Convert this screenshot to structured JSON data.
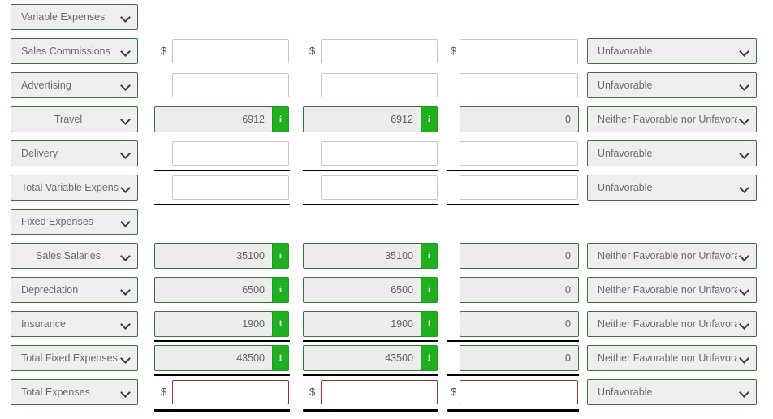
{
  "colors": {
    "select_border": "#3a7439",
    "select_fill": "#eeeeee",
    "info_green": "#1eb01e",
    "readonly_fill": "#ececec",
    "error_border": "#9b3235",
    "rule": "#000000",
    "label_text": "#6d6d6d"
  },
  "variance_options": [
    "Favorable",
    "Unfavorable",
    "Neither Favorable nor Unfavorable"
  ],
  "account_options": [
    "Variable Expenses",
    "Sales Commissions",
    "Advertising",
    "Travel",
    "Delivery",
    "Total Variable Expenses",
    "Fixed Expenses",
    "Sales Salaries",
    "Depreciation",
    "Insurance",
    "Total Fixed Expenses",
    "Total Expenses"
  ],
  "currency_symbol": "$",
  "info_icon_label": "i",
  "rows": [
    {
      "account": "Variable Expenses",
      "account_align": "left",
      "kind": "section",
      "col1": {
        "type": "none"
      },
      "col2": {
        "type": "none"
      },
      "col3": {
        "type": "none"
      },
      "variance": {
        "type": "none"
      }
    },
    {
      "account": "Sales Commissions",
      "account_align": "left",
      "kind": "entry",
      "col1": {
        "type": "input",
        "value": "",
        "dollar": true
      },
      "col2": {
        "type": "input",
        "value": "",
        "dollar": true
      },
      "col3": {
        "type": "input",
        "value": "",
        "dollar": true
      },
      "variance": {
        "type": "select",
        "value": "Unfavorable"
      }
    },
    {
      "account": "Advertising",
      "account_align": "left",
      "kind": "entry",
      "col1": {
        "type": "input",
        "value": "",
        "dollar": false
      },
      "col2": {
        "type": "input",
        "value": "",
        "dollar": false
      },
      "col3": {
        "type": "input",
        "value": "",
        "dollar": false
      },
      "variance": {
        "type": "select",
        "value": "Unfavorable"
      }
    },
    {
      "account": "Travel",
      "account_align": "center",
      "kind": "computed",
      "col1": {
        "type": "readonly",
        "value": "6912",
        "info": true
      },
      "col2": {
        "type": "readonly",
        "value": "6912",
        "info": true
      },
      "col3": {
        "type": "readonly",
        "value": "0",
        "info": false
      },
      "variance": {
        "type": "select",
        "value": "Neither Favorable nor Unfavorable"
      }
    },
    {
      "account": "Delivery",
      "account_align": "left",
      "kind": "entry",
      "col1": {
        "type": "input",
        "value": "",
        "dollar": false
      },
      "col2": {
        "type": "input",
        "value": "",
        "dollar": false
      },
      "col3": {
        "type": "input",
        "value": "",
        "dollar": false
      },
      "variance": {
        "type": "select",
        "value": "Unfavorable"
      }
    },
    {
      "account": "Total Variable Expenses",
      "account_align": "left",
      "kind": "total",
      "rule_above": true,
      "rule_below": true,
      "col1": {
        "type": "input",
        "value": "",
        "dollar": false
      },
      "col2": {
        "type": "input",
        "value": "",
        "dollar": false
      },
      "col3": {
        "type": "input",
        "value": "",
        "dollar": false
      },
      "variance": {
        "type": "select",
        "value": "Unfavorable"
      }
    },
    {
      "account": "Fixed Expenses",
      "account_align": "left",
      "kind": "section",
      "col1": {
        "type": "none"
      },
      "col2": {
        "type": "none"
      },
      "col3": {
        "type": "none"
      },
      "variance": {
        "type": "none"
      }
    },
    {
      "account": "Sales Salaries",
      "account_align": "center",
      "kind": "computed",
      "col1": {
        "type": "readonly",
        "value": "35100",
        "info": true
      },
      "col2": {
        "type": "readonly",
        "value": "35100",
        "info": true
      },
      "col3": {
        "type": "readonly",
        "value": "0",
        "info": false
      },
      "variance": {
        "type": "select",
        "value": "Neither Favorable nor Unfavorable"
      }
    },
    {
      "account": "Depreciation",
      "account_align": "left",
      "kind": "computed",
      "col1": {
        "type": "readonly",
        "value": "6500",
        "info": true
      },
      "col2": {
        "type": "readonly",
        "value": "6500",
        "info": true
      },
      "col3": {
        "type": "readonly",
        "value": "0",
        "info": false
      },
      "variance": {
        "type": "select",
        "value": "Neither Favorable nor Unfavorable"
      }
    },
    {
      "account": "Insurance",
      "account_align": "left",
      "kind": "computed",
      "col1": {
        "type": "readonly",
        "value": "1900",
        "info": true
      },
      "col2": {
        "type": "readonly",
        "value": "1900",
        "info": true
      },
      "col3": {
        "type": "readonly",
        "value": "0",
        "info": false
      },
      "variance": {
        "type": "select",
        "value": "Neither Favorable nor Unfavorable"
      }
    },
    {
      "account": "Total Fixed Expenses",
      "account_align": "left",
      "kind": "total",
      "rule_above": true,
      "rule_below": true,
      "col1": {
        "type": "readonly",
        "value": "43500",
        "info": true
      },
      "col2": {
        "type": "readonly",
        "value": "43500",
        "info": true
      },
      "col3": {
        "type": "readonly",
        "value": "0",
        "info": false
      },
      "variance": {
        "type": "select",
        "value": "Neither Favorable nor Unfavorable"
      }
    },
    {
      "account": "Total Expenses",
      "account_align": "left",
      "kind": "grandtotal",
      "rule_below_thick": true,
      "col1": {
        "type": "input",
        "value": "",
        "dollar": true,
        "error": true
      },
      "col2": {
        "type": "input",
        "value": "",
        "dollar": true,
        "error": true
      },
      "col3": {
        "type": "input",
        "value": "",
        "dollar": true,
        "error": true
      },
      "variance": {
        "type": "select",
        "value": "Unfavorable"
      }
    }
  ]
}
